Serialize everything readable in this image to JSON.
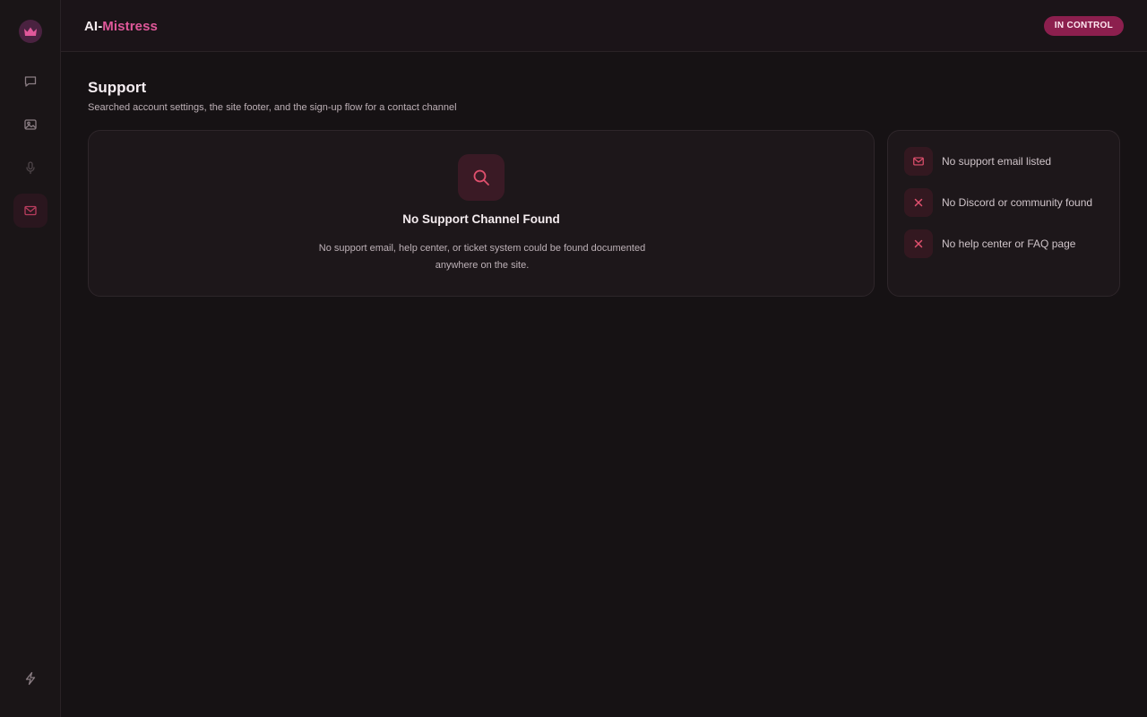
{
  "app": {
    "brand_part1": "AI-",
    "brand_part2": "Mistress",
    "status_pill": "IN CONTROL"
  },
  "sidebar": {
    "items": [
      {
        "name": "chat",
        "icon": "chat-bubble-icon",
        "active": false
      },
      {
        "name": "images",
        "icon": "image-icon",
        "active": false
      },
      {
        "name": "voice",
        "icon": "microphone-icon",
        "active": false
      },
      {
        "name": "support",
        "icon": "mail-icon",
        "active": true
      }
    ],
    "footer_icon": "lightning-icon",
    "logo_icon": "crown-icon"
  },
  "page": {
    "title": "Support",
    "subtitle": "Searched account settings, the site footer, and the sign-up flow for a contact channel"
  },
  "empty_state": {
    "icon": "search-icon",
    "title": "No Support Channel Found",
    "description": "No support email, help center, or ticket system could be found documented anywhere on the site."
  },
  "checks": [
    {
      "icon": "mail-icon",
      "label": "No support email listed"
    },
    {
      "icon": "close-icon",
      "label": "No Discord or community found"
    },
    {
      "icon": "close-icon",
      "label": "No help center or FAQ page"
    }
  ],
  "colors": {
    "background": "#161214",
    "accent": "#e0589a",
    "pill": "#8c1f4e",
    "icon_accent": "#e0506e"
  }
}
